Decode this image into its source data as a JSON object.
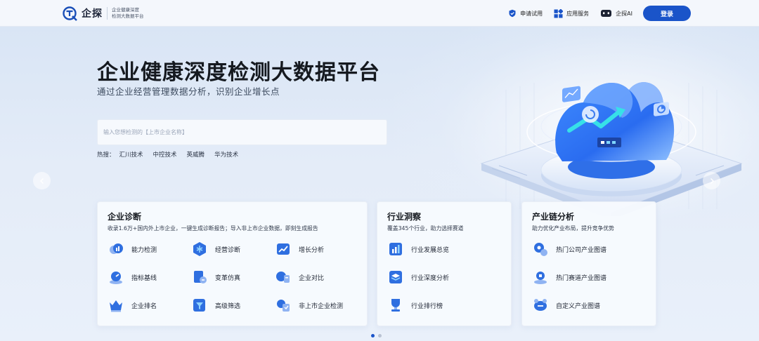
{
  "header": {
    "logo_name": "企探",
    "logo_sub_line1": "企业健康深度",
    "logo_sub_line2": "检测大数据平台",
    "nav": [
      {
        "label": "申请试用",
        "icon": "shield-check-icon"
      },
      {
        "label": "应用服务",
        "icon": "grid-apps-icon"
      },
      {
        "label": "企探AI",
        "icon": "robot-icon"
      }
    ],
    "login_label": "登录"
  },
  "hero": {
    "title": "企业健康深度检测大数据平台",
    "subtitle": "通过企业经营管理数据分析，识别企业增长点",
    "search_placeholder": "输入您想检测的【上市企业名称】",
    "hot_label": "热搜：",
    "hot_items": [
      "汇川技术",
      "中控技术",
      "英威腾",
      "华为技术"
    ]
  },
  "cards": [
    {
      "title": "企业诊断",
      "desc": "收录1.6万+国内外上市企业，一键生成诊断报告；导入非上市企业数据，即刻生成报告",
      "items": [
        "能力检测",
        "经营诊断",
        "增长分析",
        "指标基线",
        "变革仿真",
        "企业对比",
        "企业排名",
        "高级筛选",
        "非上市企业检测"
      ]
    },
    {
      "title": "行业洞察",
      "desc": "覆盖345个行业，助力选择赛道",
      "items": [
        "行业发展总览",
        "行业深度分析",
        "行业排行榜"
      ]
    },
    {
      "title": "产业链分析",
      "desc": "助力优化产业布局，提升竞争优势",
      "items": [
        "热门公司产业图谱",
        "热门赛道产业图谱",
        "自定义产业图谱"
      ]
    }
  ],
  "carousel": {
    "active_index": 0,
    "count": 2
  },
  "colors": {
    "brand": "#1a54c9",
    "icon_blue": "#2f6fe0",
    "icon_light": "#8fb3f2"
  }
}
